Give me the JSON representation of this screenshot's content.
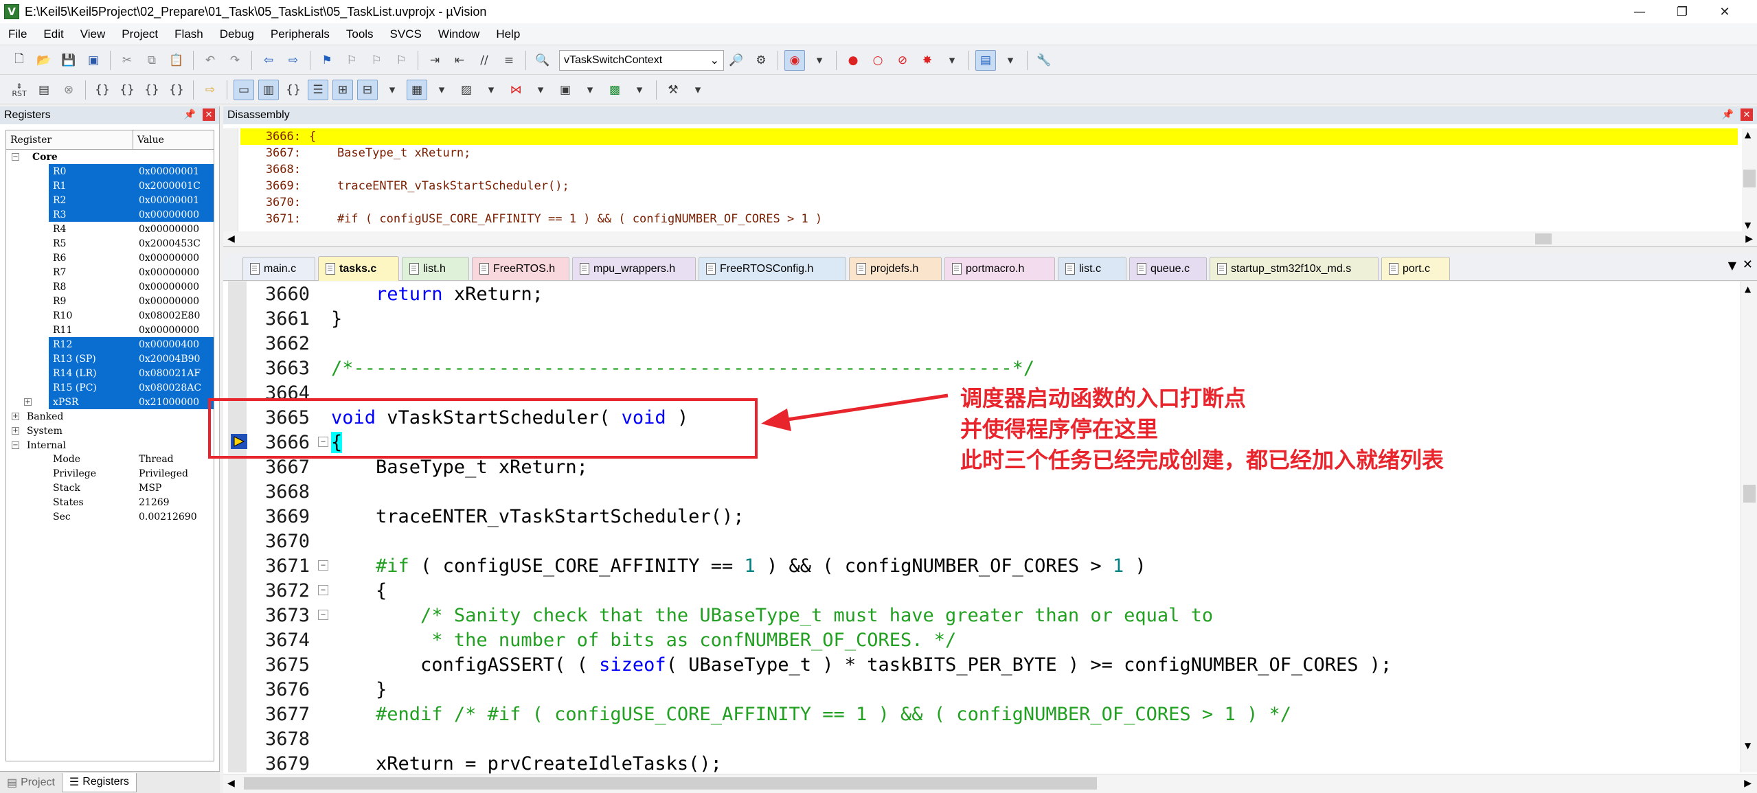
{
  "window": {
    "title": "E:\\Keil5\\Keil5Project\\02_Prepare\\01_Task\\05_TaskList\\05_TaskList.uvprojx - µVision",
    "icon_letter": "V",
    "minimize": "—",
    "restore": "❐",
    "close": "✕"
  },
  "menu": [
    "File",
    "Edit",
    "View",
    "Project",
    "Flash",
    "Debug",
    "Peripherals",
    "Tools",
    "SVCS",
    "Window",
    "Help"
  ],
  "toolbar": {
    "function_combo": "vTaskSwitchContext",
    "rst_label": "RST"
  },
  "registers_panel": {
    "title": "Registers",
    "col_register": "Register",
    "col_value": "Value",
    "core_label": "Core",
    "core": [
      {
        "name": "R0",
        "value": "0x00000001",
        "selected": true
      },
      {
        "name": "R1",
        "value": "0x2000001C",
        "selected": true
      },
      {
        "name": "R2",
        "value": "0x00000001",
        "selected": true
      },
      {
        "name": "R3",
        "value": "0x00000000",
        "selected": true
      },
      {
        "name": "R4",
        "value": "0x00000000",
        "selected": false
      },
      {
        "name": "R5",
        "value": "0x2000453C",
        "selected": false
      },
      {
        "name": "R6",
        "value": "0x00000000",
        "selected": false
      },
      {
        "name": "R7",
        "value": "0x00000000",
        "selected": false
      },
      {
        "name": "R8",
        "value": "0x00000000",
        "selected": false
      },
      {
        "name": "R9",
        "value": "0x00000000",
        "selected": false
      },
      {
        "name": "R10",
        "value": "0x08002E80",
        "selected": false
      },
      {
        "name": "R11",
        "value": "0x00000000",
        "selected": false
      },
      {
        "name": "R12",
        "value": "0x00000400",
        "selected": true
      },
      {
        "name": "R13 (SP)",
        "value": "0x20004B90",
        "selected": true
      },
      {
        "name": "R14 (LR)",
        "value": "0x080021AF",
        "selected": true
      },
      {
        "name": "R15 (PC)",
        "value": "0x080028AC",
        "selected": true
      },
      {
        "name": "xPSR",
        "value": "0x21000000",
        "selected": true
      }
    ],
    "banked_label": "Banked",
    "system_label": "System",
    "internal_label": "Internal",
    "internal": [
      {
        "name": "Mode",
        "value": "Thread"
      },
      {
        "name": "Privilege",
        "value": "Privileged"
      },
      {
        "name": "Stack",
        "value": "MSP"
      },
      {
        "name": "States",
        "value": "21269"
      },
      {
        "name": "Sec",
        "value": "0.00212690"
      }
    ],
    "bottom_tabs": [
      "Project",
      "Registers"
    ]
  },
  "disassembly": {
    "title": "Disassembly",
    "lines": [
      {
        "ln": "3666:",
        "text": "{",
        "highlight": true
      },
      {
        "ln": "3667:",
        "text": "    BaseType_t xReturn;",
        "highlight": false
      },
      {
        "ln": "3668:",
        "text": "",
        "highlight": false
      },
      {
        "ln": "3669:",
        "text": "    traceENTER_vTaskStartScheduler();",
        "highlight": false
      },
      {
        "ln": "3670:",
        "text": "",
        "highlight": false
      },
      {
        "ln": "3671:",
        "text": "    #if ( configUSE_CORE_AFFINITY == 1 ) && ( configNUMBER_OF_CORES > 1 )",
        "highlight": false
      }
    ]
  },
  "file_tabs": [
    {
      "label": "main.c",
      "color": "#e9eef7",
      "active": false
    },
    {
      "label": "tasks.c",
      "color": "#fdf6c3",
      "active": true
    },
    {
      "label": "list.h",
      "color": "#dff1d8",
      "active": false
    },
    {
      "label": "FreeRTOS.h",
      "color": "#f8d8dc",
      "active": false
    },
    {
      "label": "mpu_wrappers.h",
      "color": "#e8dff2",
      "active": false
    },
    {
      "label": "FreeRTOSConfig.h",
      "color": "#dbe9f6",
      "active": false
    },
    {
      "label": "projdefs.h",
      "color": "#fbe4cc",
      "active": false
    },
    {
      "label": "portmacro.h",
      "color": "#f4dcef",
      "active": false
    },
    {
      "label": "list.c",
      "color": "#dbe7f5",
      "active": false
    },
    {
      "label": "queue.c",
      "color": "#e6dcf1",
      "active": false
    },
    {
      "label": "startup_stm32f10x_md.s",
      "color": "#eef0d8",
      "active": false
    },
    {
      "label": "port.c",
      "color": "#fbf6cf",
      "active": false
    }
  ],
  "editor_lines": [
    {
      "num": "3660",
      "fold": "",
      "html": "    <span class='kw'>return</span> xReturn;"
    },
    {
      "num": "3661",
      "fold": "",
      "html": "}"
    },
    {
      "num": "3662",
      "fold": "",
      "html": ""
    },
    {
      "num": "3663",
      "fold": "",
      "html": "<span class='cm'>/*-----------------------------------------------------------*/</span>"
    },
    {
      "num": "3664",
      "fold": "",
      "html": ""
    },
    {
      "num": "3665",
      "fold": "",
      "html": "<span class='kw'>void</span> vTaskStartScheduler( <span class='kw'>void</span> )"
    },
    {
      "num": "3666",
      "fold": "−",
      "html": "<span class='brace-hl'>{</span>"
    },
    {
      "num": "3667",
      "fold": "",
      "html": "    BaseType_t xReturn;"
    },
    {
      "num": "3668",
      "fold": "",
      "html": ""
    },
    {
      "num": "3669",
      "fold": "",
      "html": "    traceENTER_vTaskStartScheduler();"
    },
    {
      "num": "3670",
      "fold": "",
      "html": ""
    },
    {
      "num": "3671",
      "fold": "−",
      "html": "    <span class='pp'>#if</span> ( configUSE_CORE_AFFINITY == <span class='nb'>1</span> ) &amp;&amp; ( configNUMBER_OF_CORES &gt; <span class='nb'>1</span> )"
    },
    {
      "num": "3672",
      "fold": "−",
      "html": "    {"
    },
    {
      "num": "3673",
      "fold": "−",
      "html": "        <span class='cm'>/* Sanity check that the UBaseType_t must have greater than or equal to</span>"
    },
    {
      "num": "3674",
      "fold": "",
      "html": "<span class='cm'>         * the number of bits as confNUMBER_OF_CORES. */</span>"
    },
    {
      "num": "3675",
      "fold": "",
      "html": "        configASSERT( ( <span class='kw'>sizeof</span>( UBaseType_t ) * taskBITS_PER_BYTE ) &gt;= configNUMBER_OF_CORES );"
    },
    {
      "num": "3676",
      "fold": "",
      "html": "    }"
    },
    {
      "num": "3677",
      "fold": "",
      "html": "    <span class='pp'>#endif /* #if ( configUSE_CORE_AFFINITY == 1 ) &amp;&amp; ( configNUMBER_OF_CORES &gt; 1 ) */</span>"
    },
    {
      "num": "3678",
      "fold": "",
      "html": ""
    },
    {
      "num": "3679",
      "fold": "",
      "html": "    xReturn = prvCreateIdleTasks();"
    }
  ],
  "annotation": {
    "lines": [
      "调度器启动函数的入口打断点",
      "并使得程序停在这里",
      "此时三个任务已经完成创建，都已经加入就绪列表"
    ],
    "color": "#e8242c"
  }
}
